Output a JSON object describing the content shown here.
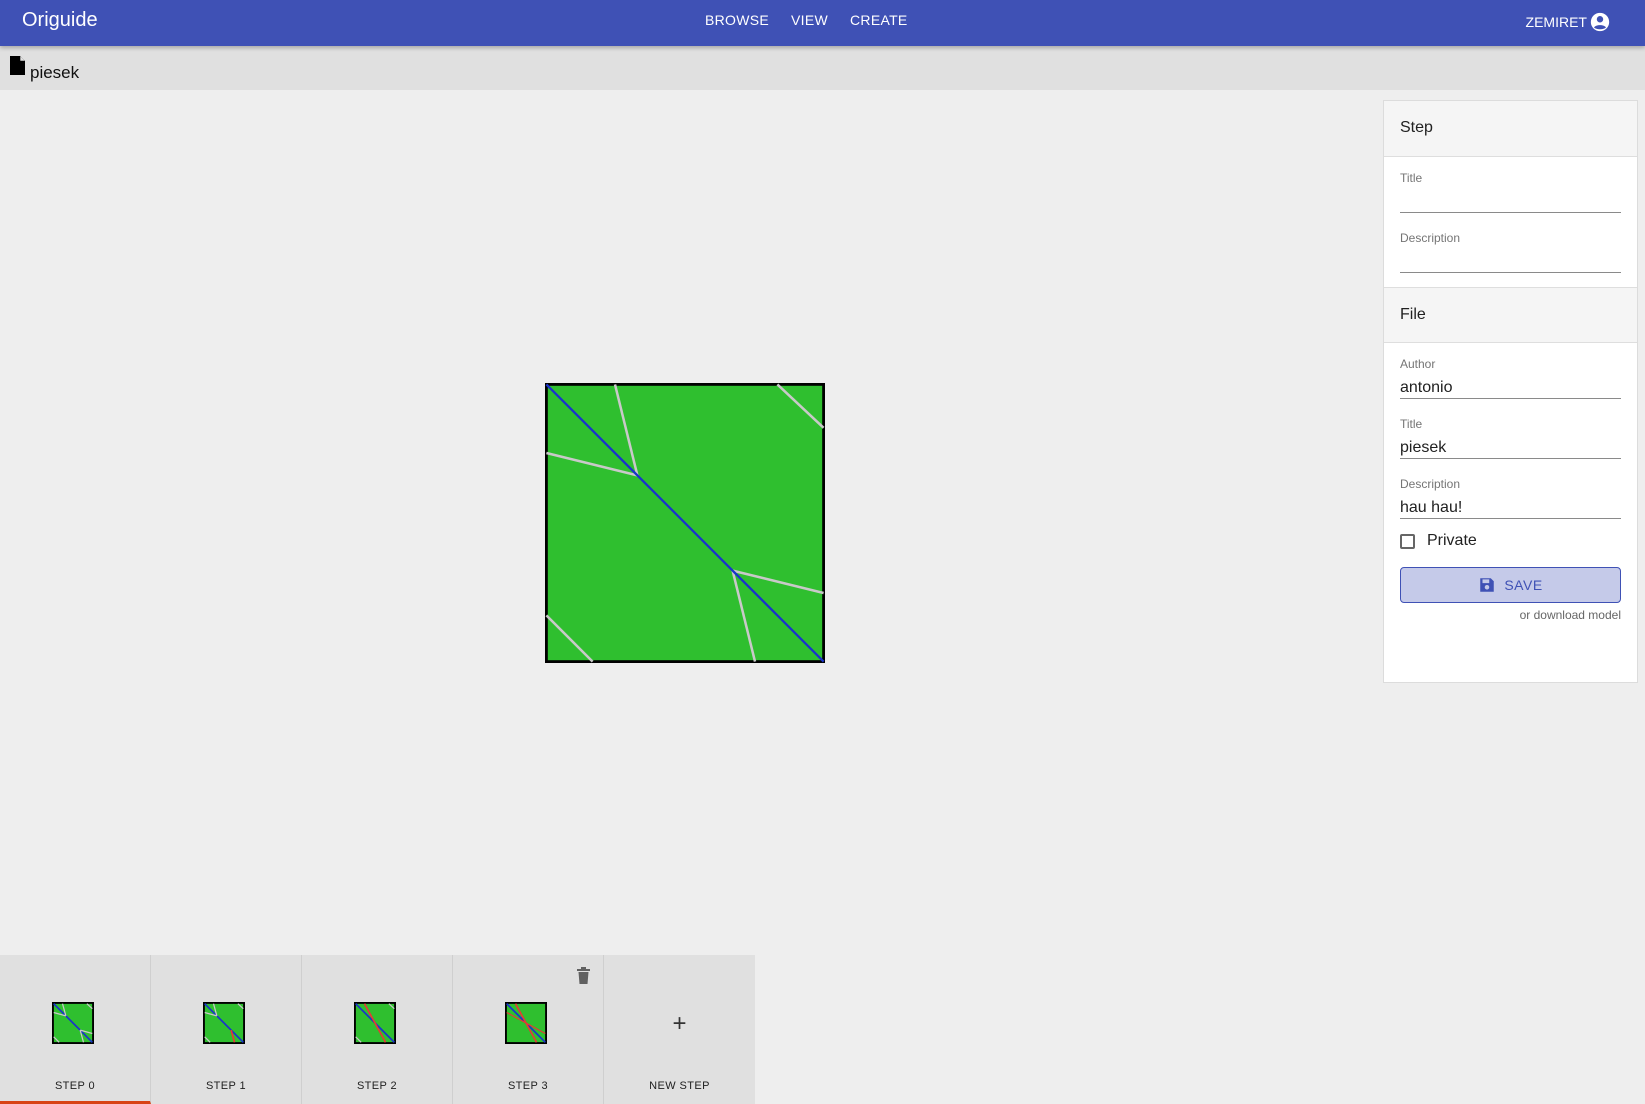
{
  "app": {
    "brand": "Origuide",
    "nav": [
      "BROWSE",
      "VIEW",
      "CREATE"
    ],
    "user": "ZEMIRET",
    "user_icon": "account-circle-icon"
  },
  "file": {
    "icon": "file-icon",
    "name": "piesek"
  },
  "colors": {
    "appbar": "#3f51b5",
    "paper": "#2fbf2f",
    "valley_fold": "#1a33cc",
    "mountain_fold": "#e53935",
    "crease": "#c9c9c9",
    "active_step": "#d84315"
  },
  "panel": {
    "step_section": {
      "header": "Step",
      "title_label": "Title",
      "title_value": "",
      "description_label": "Description",
      "description_value": ""
    },
    "file_section": {
      "header": "File",
      "author_label": "Author",
      "author_value": "antonio",
      "title_label": "Title",
      "title_value": "piesek",
      "description_label": "Description",
      "description_value": "hau hau!",
      "private_label": "Private",
      "private_checked": false,
      "save_label": "SAVE",
      "save_icon": "floppy-disk-icon",
      "download_text": "or download model"
    }
  },
  "steps": {
    "items": [
      {
        "label": "STEP 0",
        "active": true
      },
      {
        "label": "STEP 1",
        "active": false
      },
      {
        "label": "STEP 2",
        "active": false
      },
      {
        "label": "STEP 3",
        "active": false,
        "deletable": true
      }
    ],
    "new_step_label": "NEW STEP",
    "new_step_icon": "plus-icon",
    "delete_icon": "trash-icon"
  }
}
